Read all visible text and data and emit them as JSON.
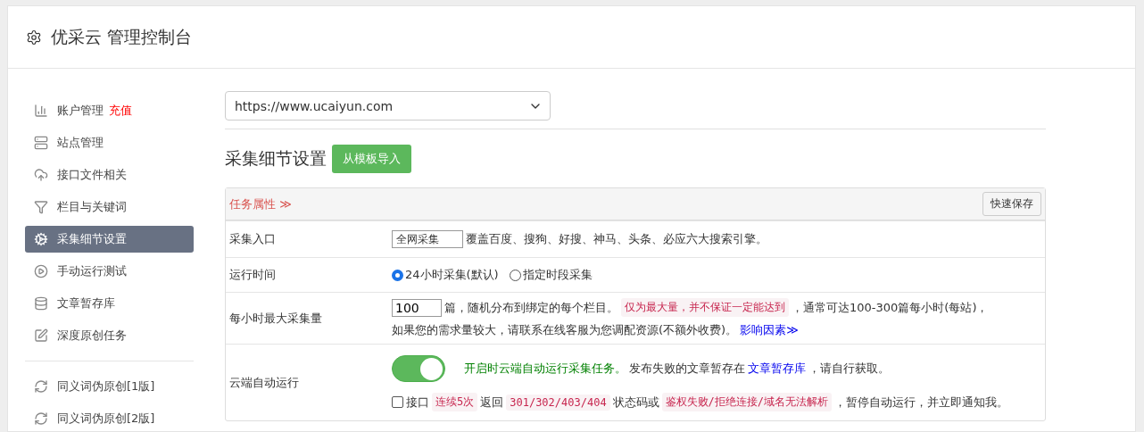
{
  "header": {
    "title": "优采云 管理控制台"
  },
  "sidebar": {
    "groups": [
      [
        {
          "label": "账户管理",
          "badge": "充值",
          "selected": false
        },
        {
          "label": "站点管理",
          "selected": false
        },
        {
          "label": "接口文件相关",
          "selected": false
        },
        {
          "label": "栏目与关键词",
          "selected": false
        },
        {
          "label": "采集细节设置",
          "selected": true
        },
        {
          "label": "手动运行测试",
          "selected": false
        },
        {
          "label": "文章暂存库",
          "selected": false
        },
        {
          "label": "深度原创任务",
          "selected": false
        }
      ],
      [
        {
          "label": "同义词伪原创[1版]",
          "selected": false
        },
        {
          "label": "同义词伪原创[2版]",
          "selected": false
        }
      ]
    ]
  },
  "site_select": {
    "value": "https://www.ucaiyun.com"
  },
  "section": {
    "title": "采集细节设置",
    "import_button": "从模板导入"
  },
  "panel": {
    "heading": "任务属性 ≫",
    "save_button": "快速保存",
    "rows": [
      {
        "kind": "entry",
        "label": "采集入口",
        "select_value": "全网采集",
        "note": "覆盖百度、搜狗、好搜、神马、头条、必应六大搜索引擎。"
      },
      {
        "kind": "radios",
        "label": "运行时间",
        "options": [
          {
            "label": "24小时采集(默认)",
            "selected": true
          },
          {
            "label": "指定时段采集",
            "selected": false
          }
        ]
      },
      {
        "kind": "amount",
        "label": "每小时最大采集量",
        "value": "100",
        "lines": [
          [
            {
              "kind": "text",
              "text": "篇，随机分布到绑定的每个栏目。"
            },
            {
              "kind": "code",
              "text": "仅为最大量，并不保证一定能达到"
            },
            {
              "kind": "text",
              "text": "，通常可达100-300篇每小时(每站)，"
            }
          ],
          [
            {
              "kind": "text",
              "text": "如果您的需求量较大，请联系在线客服为您调配资源(不额外收费)。"
            },
            {
              "kind": "link",
              "text": "影响因素≫"
            }
          ]
        ]
      },
      {
        "kind": "cloud",
        "label": "云端自动运行",
        "on": true,
        "lines": [
          [
            {
              "kind": "green",
              "text": "开启时云端自动运行采集任务。"
            },
            {
              "kind": "text",
              "text": "发布失败的文章暂存在"
            },
            {
              "kind": "link",
              "text": "文章暂存库"
            },
            {
              "kind": "text",
              "text": "，请自行获取。"
            }
          ],
          [
            {
              "kind": "check",
              "text": "接口",
              "checked": false
            },
            {
              "kind": "code",
              "text": "连续5次"
            },
            {
              "kind": "text",
              "text": "返回"
            },
            {
              "kind": "code",
              "text": "301/302/403/404"
            },
            {
              "kind": "text",
              "text": "状态码或"
            },
            {
              "kind": "code",
              "text": "鉴权失败/拒绝连接/域名无法解析"
            },
            {
              "kind": "text",
              "text": "，暂停自动运行，并立即通知我。"
            }
          ]
        ]
      }
    ]
  }
}
